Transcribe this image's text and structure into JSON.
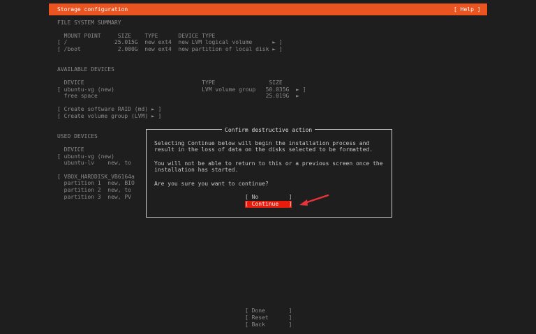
{
  "header": {
    "title": "Storage configuration",
    "help": "[ Help ]"
  },
  "fs_summary": {
    "heading": "FILE SYSTEM SUMMARY",
    "columns": "  MOUNT POINT     SIZE    TYPE      DEVICE TYPE",
    "rows": [
      "[ /              25.015G  new ext4  new LVM logical volume      ► ]",
      "[ /boot           2.000G  new ext4  new partition of local disk ► ]"
    ]
  },
  "available": {
    "heading": "AVAILABLE DEVICES",
    "columns": "  DEVICE                                   TYPE                SIZE",
    "rows": [
      "[ ubuntu-vg (new)                          LVM volume group   50.035G  ► ]",
      "  free space                                                  25.019G  ►"
    ],
    "actions": [
      "[ Create software RAID (md) ► ]",
      "[ Create volume group (LVM) ► ]"
    ]
  },
  "used": {
    "heading": "USED DEVICES",
    "lines": [
      "  DEVICE",
      "[ ubuntu-vg (new)",
      "  ubuntu-lv    new, to",
      "",
      "[ VBOX_HARDDISK_VB6164a",
      "  partition 1  new, BIO",
      "  partition 2  new, to",
      "  partition 3  new, PV"
    ]
  },
  "dialog": {
    "title": "Confirm destructive action",
    "text": [
      "Selecting Continue below will begin the installation process and",
      "result in the loss of data on the disks selected to be formatted.",
      "",
      "You will not be able to return to this or a previous screen once the",
      "installation has started.",
      "",
      "Are you sure you want to continue?"
    ],
    "no": "[ No         ]",
    "continue": "[ Continue   ]",
    "accent": "#e81c0c"
  },
  "footer": {
    "done": "[ Done       ]",
    "reset": "[ Reset      ]",
    "back": "[ Back       ]"
  },
  "colors": {
    "header": "#e95420",
    "background": "#1e1e1e",
    "annotation_arrow": "#e8333a"
  }
}
